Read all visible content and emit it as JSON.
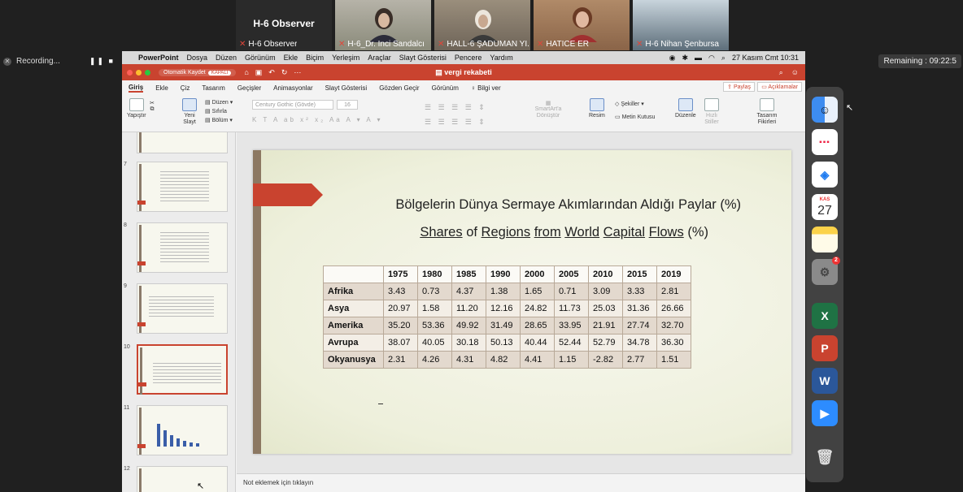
{
  "zoom": {
    "tiles": [
      {
        "name": "H-6 Observer",
        "big": "H-6 Observer",
        "bg": "#2a2a2a"
      },
      {
        "name": "H-6_Dr. İnci Sandalcı",
        "big": "",
        "bg": "#8a8a7a"
      },
      {
        "name": "HALL-6 ŞADUMAN Yİ...",
        "big": "",
        "bg": "#6e6458"
      },
      {
        "name": "HATİCE ER",
        "big": "",
        "bg": "#8a6448"
      },
      {
        "name": "H-6 Nihan Şenbursa",
        "big": "",
        "bg": "#5d6e7a"
      }
    ],
    "recording_label": "Recording...",
    "remaining_label": "Remaining : 09:22:5"
  },
  "menubar": {
    "items": [
      "PowerPoint",
      "Dosya",
      "Düzen",
      "Görünüm",
      "Ekle",
      "Biçim",
      "Yerleşim",
      "Araçlar",
      "Slayt Gösterisi",
      "Pencere",
      "Yardım"
    ],
    "datetime": "27 Kasım Cmt  10:31"
  },
  "titlebar": {
    "autosave_label": "Otomatik Kaydet",
    "autosave_state": "KAPALI",
    "doc_title": "vergi rekabeti"
  },
  "tabs": {
    "items": [
      "Giriş",
      "Ekle",
      "Çiz",
      "Tasarım",
      "Geçişler",
      "Animasyonlar",
      "Slayt Gösterisi",
      "Gözden Geçir",
      "Görünüm",
      "Bilgi ver"
    ],
    "share_label": "Paylaş",
    "comments_label": "Açıklamalar"
  },
  "ribbon": {
    "paste": "Yapıştır",
    "new_slide": "Yeni Slayt",
    "layout": "Düzen",
    "reset": "Sıfırla",
    "section": "Bölüm",
    "font": "Century Gothic (Gövde)",
    "size": "16",
    "smartart": "SmartArt'a Dönüştür",
    "picture": "Resim",
    "shapes": "Şekiller",
    "textbox": "Metin Kutusu",
    "arrange": "Düzenle",
    "quick_styles": "Hızlı Stiller",
    "designer": "Tasarım Fikirleri"
  },
  "thumbnails": [
    {
      "num": "7"
    },
    {
      "num": "8"
    },
    {
      "num": "9"
    },
    {
      "num": "10"
    },
    {
      "num": "11"
    },
    {
      "num": "12"
    }
  ],
  "slide": {
    "title_tr": "Bölgelerin Dünya Sermaye Akımlarından Aldığı Paylar (%)",
    "title_en": {
      "w1": "Shares",
      "w2": "of",
      "w3": "Regions",
      "w4": "from",
      "w5": "World",
      "w6": "Capital",
      "w7": "Flows",
      "w8": "(%)"
    },
    "table": {
      "years": [
        "1975",
        "1980",
        "1985",
        "1990",
        "2000",
        "2005",
        "2010",
        "2015",
        "2019"
      ],
      "rows": [
        {
          "region": "Afrika",
          "values": [
            "3.43",
            "0.73",
            "4.37",
            "1.38",
            "1.65",
            "0.71",
            "3.09",
            "3.33",
            "2.81"
          ]
        },
        {
          "region": "Asya",
          "values": [
            "20.97",
            "1.58",
            "11.20",
            "12.16",
            "24.82",
            "11.73",
            "25.03",
            "31.36",
            "26.66"
          ]
        },
        {
          "region": "Amerika",
          "values": [
            "35.20",
            "53.36",
            "49.92",
            "31.49",
            "28.65",
            "33.95",
            "21.91",
            "27.74",
            "32.70"
          ]
        },
        {
          "region": "Avrupa",
          "values": [
            "38.07",
            "40.05",
            "30.18",
            "50.13",
            "40.44",
            "52.44",
            "52.79",
            "34.78",
            "36.30"
          ]
        },
        {
          "region": "Okyanusya",
          "values": [
            "2.31",
            "4.26",
            "4.31",
            "4.82",
            "4.41",
            "1.15",
            "-2.82",
            "2.77",
            "1.51"
          ]
        }
      ]
    }
  },
  "notes_placeholder": "Not eklemek için tıklayın",
  "dock": {
    "calendar_month": "KAS",
    "calendar_day": "27",
    "settings_badge": "2"
  },
  "colors": {
    "accent": "#c9432f",
    "slide_bar": "#8c7862"
  }
}
